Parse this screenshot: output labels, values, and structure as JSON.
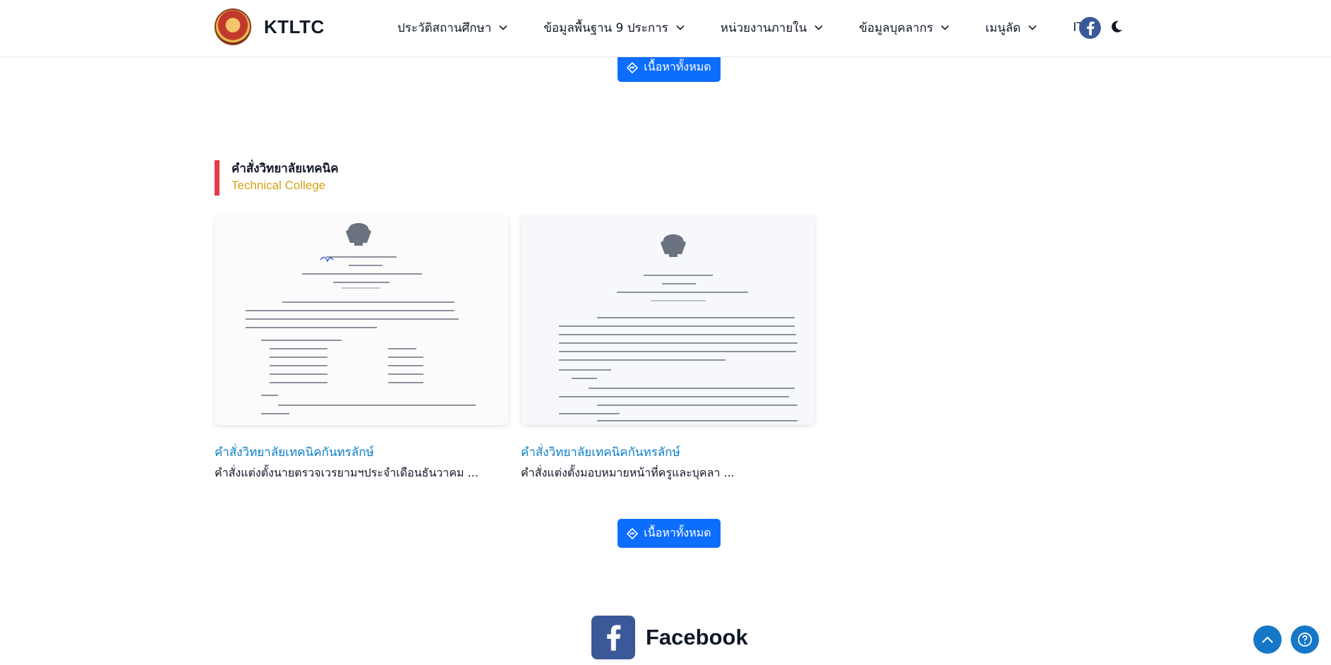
{
  "header": {
    "brand": "KTLTC",
    "menu": [
      {
        "label": "ประวัติสถานศึกษา",
        "icon": "chevron-down-icon"
      },
      {
        "label": "ข้อมูลพื้นฐาน 9 ประการ",
        "icon": "chevron-down-icon"
      },
      {
        "label": "หน่วยงานภายใน",
        "icon": "chevron-down-icon"
      },
      {
        "label": "ข้อมูลบุคลากร",
        "icon": "chevron-down-icon"
      },
      {
        "label": "เมนูลัด",
        "icon": "chevron-down-icon"
      },
      {
        "label": "ITA"
      }
    ],
    "icons": [
      "logo",
      "facebook-icon",
      "moon-icon",
      "sidebar-toggle-icon"
    ]
  },
  "buttons": {
    "all_content_top": "เนื้อหาทั้งหมด",
    "all_content_bottom": "เนื้อหาทั้งหมด"
  },
  "section": {
    "title": "คำสั่งวิทยาลัยเทคนิค",
    "subtitle": "Technical College"
  },
  "cards": [
    {
      "category": "คำสั่งวิทยาลัยเทคนิคกันทรลักษ์",
      "title": "คำสั่งแต่งตั้งนายตรวจเวรยามฯประจำเดือนธันวาคม ..."
    },
    {
      "category": "คำสั่งวิทยาลัยเทคนิคกันทรลักษ์",
      "title": "คำสั่งแต่งตั้งมอบหมายหน้าที่ครูและบุคลา ..."
    }
  ],
  "footer": {
    "facebook_label": "Facebook"
  },
  "colors": {
    "primary": "#0d6efd",
    "accent_red": "#e63946",
    "accent_gold": "#d4a017",
    "link_blue": "#0b7fc7",
    "facebook": "#3b5998"
  }
}
